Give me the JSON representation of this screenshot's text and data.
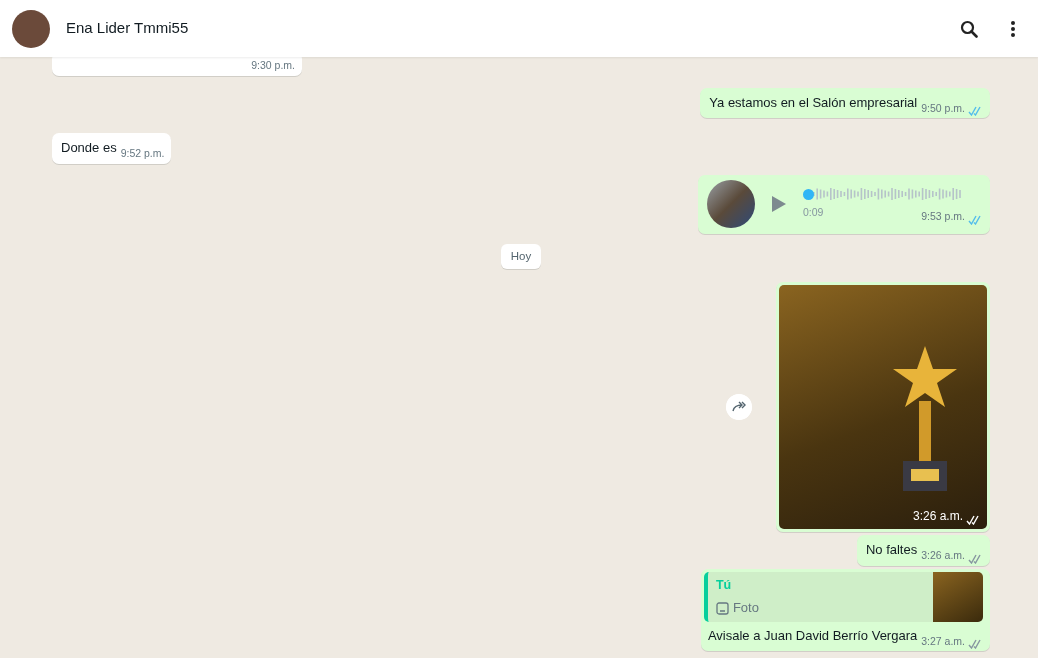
{
  "header": {
    "contact_name": "Ena Lider Tmmi55"
  },
  "messages": [
    {
      "kind": "cut",
      "outgoing": false,
      "time": "9:30 p.m."
    },
    {
      "kind": "text",
      "outgoing": true,
      "text": "Ya estamos en el Salón empresarial",
      "time": "9:50 p.m.",
      "read": true
    },
    {
      "kind": "text",
      "outgoing": false,
      "text": "Donde es",
      "time": "9:52 p.m."
    },
    {
      "kind": "voice",
      "outgoing": true,
      "duration": "0:09",
      "time": "9:53 p.m.",
      "read": true,
      "level": 0.0
    },
    {
      "kind": "date",
      "text": "Hoy"
    },
    {
      "kind": "image",
      "outgoing": true,
      "time": "3:26 a.m.",
      "read": false
    },
    {
      "kind": "text",
      "outgoing": true,
      "text": "No faltes",
      "time": "3:26 a.m.",
      "read": false
    },
    {
      "kind": "quote",
      "outgoing": true,
      "quote_author": "Tú",
      "quote_text": "Foto",
      "text": "Avisale a Juan David Berrío Vergara",
      "time": "3:27 a.m.",
      "read": false
    }
  ]
}
